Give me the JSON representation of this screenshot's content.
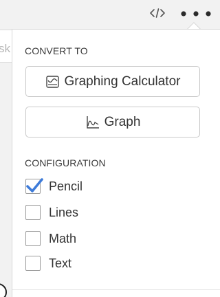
{
  "toolbar": {
    "code_icon": "code-icon",
    "more_icon": "more-horizontal-icon"
  },
  "underlying": {
    "text": "sk"
  },
  "menu": {
    "convert_heading": "CONVERT TO",
    "convert_buttons": [
      {
        "label": "Graphing Calculator",
        "icon": "calculator-icon"
      },
      {
        "label": "Graph",
        "icon": "graph-icon"
      }
    ],
    "config_heading": "CONFIGURATION",
    "options": [
      {
        "label": "Pencil",
        "checked": true
      },
      {
        "label": "Lines",
        "checked": false
      },
      {
        "label": "Math",
        "checked": false
      },
      {
        "label": "Text",
        "checked": false
      }
    ]
  },
  "colors": {
    "check_accent": "#3d7bd9",
    "border": "#c8c8c8",
    "text": "#333333"
  }
}
